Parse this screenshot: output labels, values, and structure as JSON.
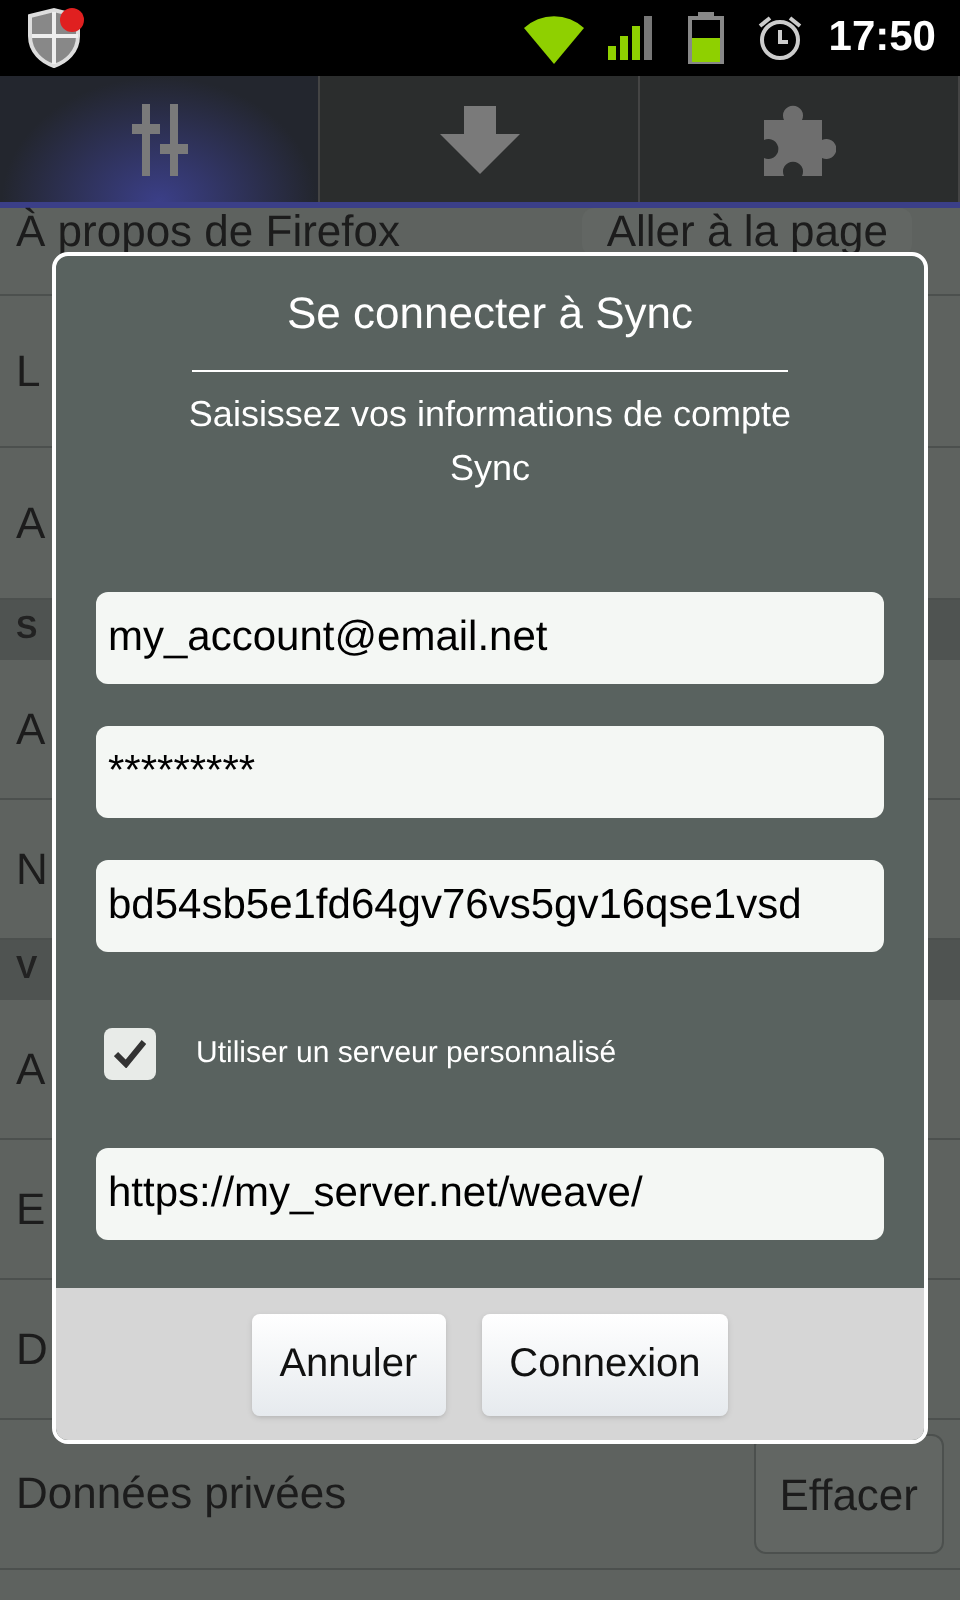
{
  "status_bar": {
    "time": "17:50"
  },
  "tabs": [
    {
      "kind": "sliders",
      "selected": true
    },
    {
      "kind": "arrow",
      "selected": false
    },
    {
      "kind": "puzzle",
      "selected": false
    }
  ],
  "settings_list": [
    {
      "kind": "row",
      "label": "À propos de Firefox",
      "button": "Aller à la page"
    },
    {
      "kind": "row",
      "label": "L"
    },
    {
      "kind": "row",
      "label": "A"
    },
    {
      "kind": "header",
      "label": "S"
    },
    {
      "kind": "row",
      "label": "A"
    },
    {
      "kind": "row",
      "label": "N"
    },
    {
      "kind": "header",
      "label": "V"
    },
    {
      "kind": "row",
      "label": "A"
    },
    {
      "kind": "row",
      "label": "E"
    },
    {
      "kind": "row",
      "label": "D"
    },
    {
      "kind": "row",
      "label": "Données privées",
      "button": "Effacer"
    }
  ],
  "dialog": {
    "title": "Se connecter à Sync",
    "subtitle": "Saisissez vos informations de compte Sync",
    "fields": [
      {
        "value": "my_account@email.net"
      },
      {
        "value": "*********"
      },
      {
        "value": "bd54sb5e1fd64gv76vs5gv16qse1vsd"
      }
    ],
    "custom_server": {
      "label": "Utiliser un serveur personnalisé",
      "checked": true
    },
    "server_field": {
      "value": "https://my_server.net/weave/"
    },
    "buttons": [
      "Annuler",
      "Connexion"
    ]
  }
}
